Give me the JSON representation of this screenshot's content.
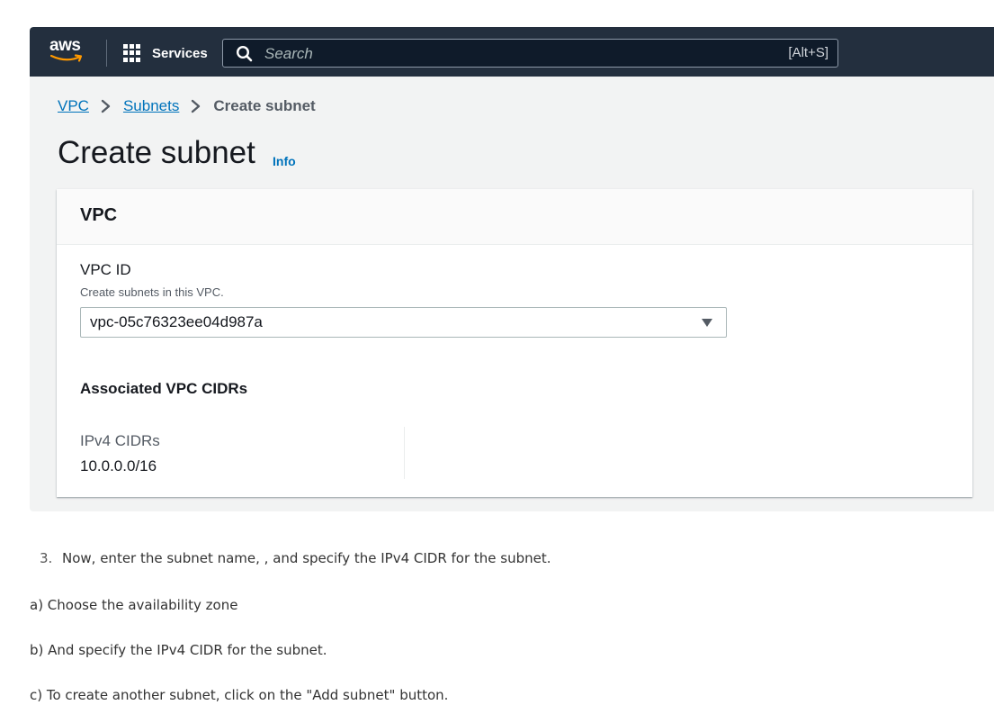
{
  "topbar": {
    "logo_text": "aws",
    "services_label": "Services",
    "search_placeholder": "Search",
    "search_shortcut": "[Alt+S]",
    "colors": {
      "background": "#232f3e",
      "logo_smile": "#ff9900"
    }
  },
  "breadcrumb": {
    "items": [
      {
        "label": "VPC"
      },
      {
        "label": "Subnets"
      },
      {
        "label": "Create subnet"
      }
    ],
    "separator": ">"
  },
  "page": {
    "title": "Create subnet",
    "info_link": "Info"
  },
  "vpc_panel": {
    "title": "VPC",
    "vpc_id_label": "VPC ID",
    "vpc_id_description": "Create subnets in this VPC.",
    "vpc_id_value": "vpc-05c76323ee04d987a",
    "associated_title": "Associated VPC CIDRs",
    "ipv4_label": "IPv4 CIDRs",
    "ipv4_value": "10.0.0.0/16"
  },
  "instructions": {
    "step_number": "3.",
    "step_text": "Now, enter the subnet name, , and specify the IPv4 CIDR for the subnet.",
    "items": [
      "a) Choose the availability zone",
      "b) And specify the IPv4 CIDR for the subnet.",
      "c) To create another subnet, click on the \"Add subnet\" button."
    ]
  },
  "colors": {
    "link": "#0073bb",
    "page_bg": "#f2f3f3"
  }
}
